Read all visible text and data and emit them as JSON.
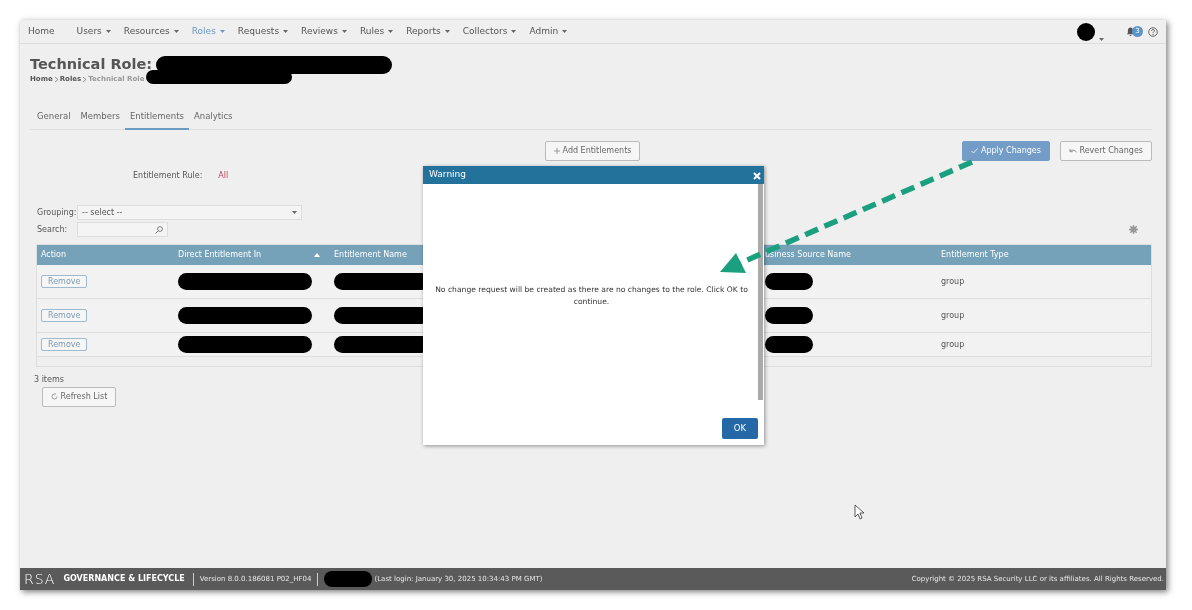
{
  "nav": {
    "items": [
      {
        "label": "Home",
        "selected": false,
        "caret": false
      },
      {
        "label": "Users",
        "selected": false,
        "caret": true
      },
      {
        "label": "Resources",
        "selected": false,
        "caret": true
      },
      {
        "label": "Roles",
        "selected": true,
        "caret": true
      },
      {
        "label": "Requests",
        "selected": false,
        "caret": true
      },
      {
        "label": "Reviews",
        "selected": false,
        "caret": true
      },
      {
        "label": "Rules",
        "selected": false,
        "caret": true
      },
      {
        "label": "Reports",
        "selected": false,
        "caret": true
      },
      {
        "label": "Collectors",
        "selected": false,
        "caret": true
      },
      {
        "label": "Admin",
        "selected": false,
        "caret": true
      }
    ],
    "notifications": "3"
  },
  "page": {
    "title": "Technical Role:",
    "breadcrumb": [
      {
        "label": "Home",
        "current": false
      },
      {
        "label": "Roles",
        "current": false
      },
      {
        "label": "Technical Role",
        "current": true
      }
    ]
  },
  "tabs": [
    {
      "label": "General",
      "selected": false
    },
    {
      "label": "Members",
      "selected": false
    },
    {
      "label": "Entitlements",
      "selected": true
    },
    {
      "label": "Analytics",
      "selected": false
    }
  ],
  "toolbar": {
    "add": "Add Entitlements",
    "apply": "Apply Changes",
    "revert": "Revert Changes"
  },
  "entitlement_rule": {
    "label": "Entitlement Rule:",
    "value": "All"
  },
  "filters": {
    "grouping_label": "Grouping:",
    "grouping_value": "-- select --",
    "search_label": "Search:"
  },
  "table": {
    "columns": [
      {
        "label": "Action",
        "sorted": false
      },
      {
        "label": "Direct Entitlement In",
        "sorted": true
      },
      {
        "label": "Entitlement Name",
        "sorted": false
      },
      {
        "label": "usiness Source Name",
        "sorted": false
      },
      {
        "label": "Entitlement Type",
        "sorted": false
      }
    ],
    "rows": [
      {
        "action": "Remove",
        "type": "group"
      },
      {
        "action": "Remove",
        "type": "group"
      },
      {
        "action": "Remove",
        "type": "group"
      }
    ]
  },
  "item_count": "3 items",
  "refresh": "Refresh List",
  "modal": {
    "title": "Warning",
    "message": "No change request will be created as there are no changes to the role. Click OK to continue.",
    "ok": "OK"
  },
  "footer": {
    "logo": "RSA",
    "product": "GOVERNANCE & LIFECYCLE",
    "version": "Version 8.0.0.186081 P02_HF04",
    "last_login": "(Last login: January 30, 2025 10:34:43 PM GMT)",
    "copyright": "Copyright © 2025 RSA Security LLC or its affiliates. All Rights Reserved."
  }
}
